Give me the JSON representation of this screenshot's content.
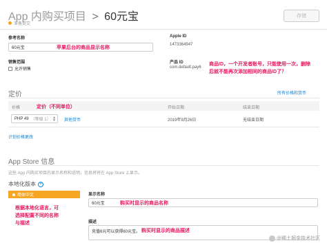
{
  "header": {
    "breadcrumb_parent": "App 内购买项目",
    "separator": ">",
    "title": "60元宝",
    "status": "准备提交",
    "save_label": "存储"
  },
  "fields": {
    "ref_name_label": "参考名称",
    "ref_name_value": "60元宝",
    "ref_name_note": "苹果后台的商品显示名称",
    "apple_id_label": "Apple ID",
    "apple_id_value": "1473364947",
    "sales_label": "销售范围",
    "sales_checkbox_label": "允许销售",
    "product_id_label": "产品 ID",
    "product_id_value": "com.default.pay6",
    "product_id_note_line1": "商品ID，一个开发者账号，只能使用一次，删除",
    "product_id_note_line2": "后就不能再次添加相同的商品ID了？"
  },
  "pricing": {
    "section_title": "定价",
    "all_prices_link": "所有价格和货币",
    "col_price": "价格",
    "col_price_note": "定价（不同单位）",
    "col_start": "开始日期",
    "col_end": "结束日期",
    "price_value": "PHP 49",
    "price_tier": "（等级 1）",
    "other_currencies_link": "其他货币",
    "start_value": "2019年9月26日",
    "end_value": "无结束日期",
    "plan_change_link": "计划价格更改"
  },
  "appstore": {
    "section_title": "App Store 信息",
    "description": "这些 App 内购买项目的显示名称和说明，信息将将在 App Store 上显示。",
    "localization_title": "本地化版本",
    "localization_item": "简体中文",
    "loc_note_line1": "根据本地化语言，可",
    "loc_note_line2": "选择配置不同的名称",
    "loc_note_line3": "与描述",
    "display_name_label": "显示名称",
    "display_name_value": "60元宝",
    "display_name_note": "购买时显示的商品名称",
    "description_label": "描述",
    "description_value": "充值6元可以获得60元宝。",
    "description_note": "购买时显示的商品描述"
  },
  "watermark": "@稀土掘金技术社区",
  "colors": {
    "accent": "#0a84d8",
    "annotation": "#e8175d",
    "status_dot": "#f5a623",
    "localization_highlight": "#f6a623"
  }
}
